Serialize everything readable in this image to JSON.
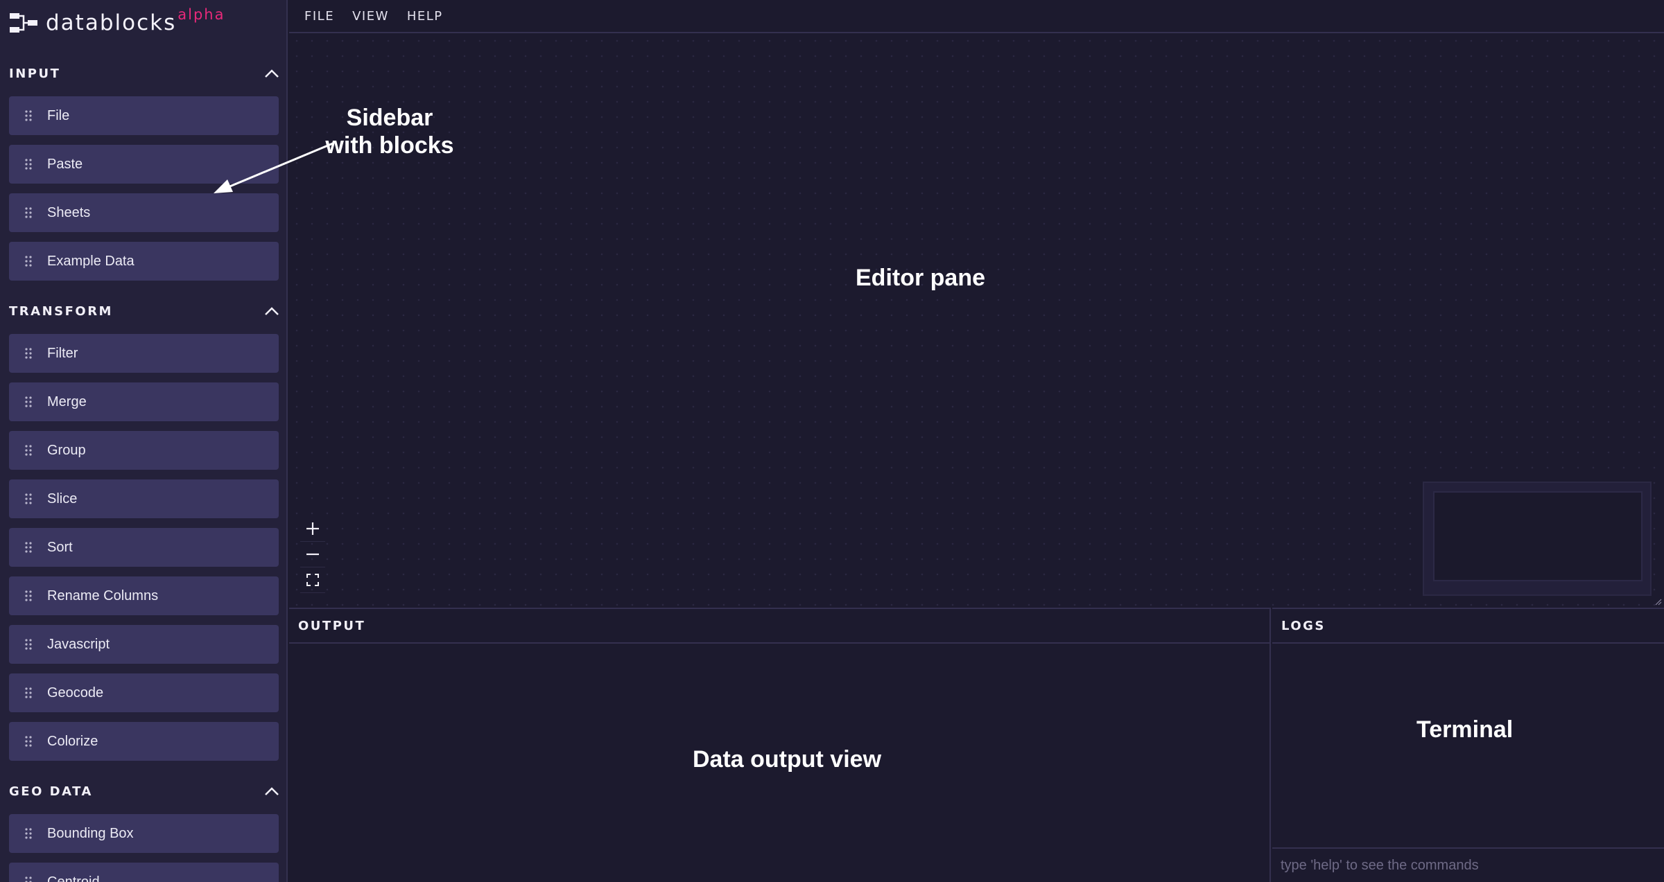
{
  "app": {
    "name": "datablocks",
    "badge": "alpha"
  },
  "menu": [
    {
      "label": "FILE"
    },
    {
      "label": "VIEW"
    },
    {
      "label": "HELP"
    }
  ],
  "sidebar": {
    "sections": [
      {
        "title": "INPUT",
        "blocks": [
          "File",
          "Paste",
          "Sheets",
          "Example Data"
        ]
      },
      {
        "title": "TRANSFORM",
        "blocks": [
          "Filter",
          "Merge",
          "Group",
          "Slice",
          "Sort",
          "Rename Columns",
          "Javascript",
          "Geocode",
          "Colorize"
        ]
      },
      {
        "title": "GEO DATA",
        "blocks": [
          "Bounding Box",
          "Centroid"
        ]
      }
    ]
  },
  "annotations": {
    "sidebar": "Sidebar with blocks",
    "editor": "Editor pane",
    "output": "Data output view",
    "terminal": "Terminal"
  },
  "output": {
    "title": "OUTPUT"
  },
  "logs": {
    "title": "LOGS",
    "placeholder": "type 'help' to see the commands"
  },
  "icons": {
    "logo": "datablocks-logo-icon",
    "collapse": "chevron-up-icon",
    "drag": "drag-handle-icon",
    "zoom_in": "plus-icon",
    "zoom_out": "minus-icon",
    "fit_view": "fit-view-icon"
  },
  "colors": {
    "background": "#1c1a2e",
    "sidebar": "#24213a",
    "block": "#3a3660",
    "accent": "#e8297a"
  }
}
